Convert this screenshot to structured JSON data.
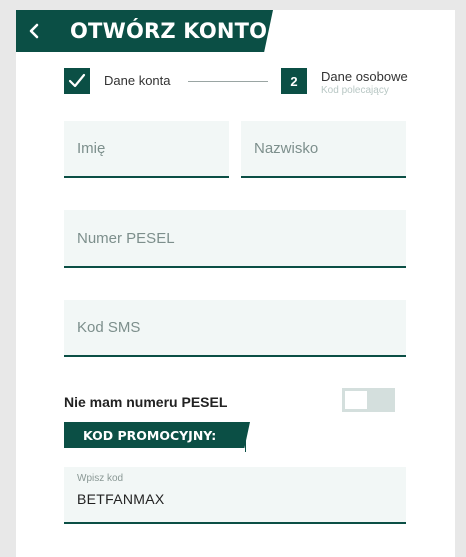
{
  "header": {
    "title": "OTWÓRZ KONTO",
    "back_icon": "chevron-left-icon"
  },
  "steps": {
    "step1": {
      "label": "Dane konta",
      "icon": "check-icon",
      "completed": true
    },
    "step2": {
      "number": "2",
      "label": "Dane osobowe",
      "sublabel": "Kod polecający"
    }
  },
  "form": {
    "first_name": {
      "placeholder": "Imię",
      "value": ""
    },
    "last_name": {
      "placeholder": "Nazwisko",
      "value": ""
    },
    "pesel": {
      "placeholder": "Numer PESEL",
      "value": ""
    },
    "sms_code": {
      "placeholder": "Kod SMS",
      "value": ""
    },
    "no_pesel": {
      "label": "Nie mam numeru PESEL",
      "enabled": false
    },
    "promo": {
      "banner": "KOD PROMOCYJNY:",
      "label": "Wpisz kod",
      "value": "BETFANMAX"
    }
  },
  "colors": {
    "brand": "#0b4f45",
    "field_bg": "#f2f7f6",
    "toggle_off": "#d4dfdd",
    "page_bg": "#e8e8e8"
  }
}
